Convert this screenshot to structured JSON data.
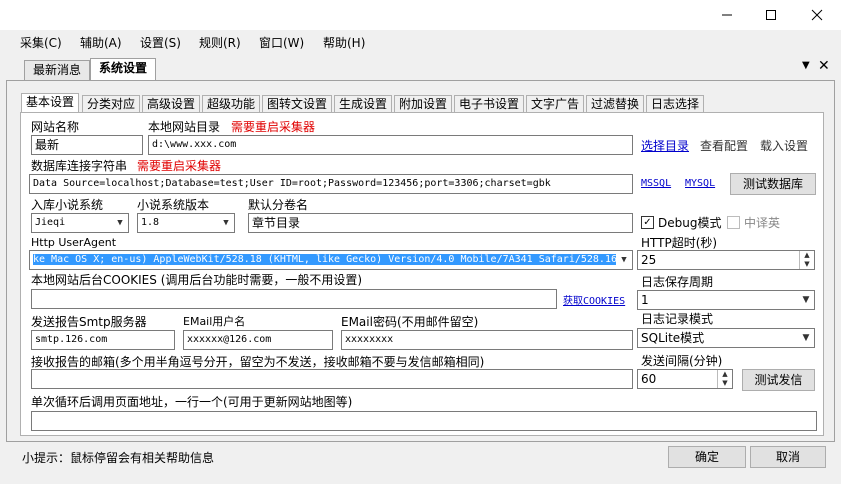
{
  "menu": {
    "items": [
      "采集(C)",
      "辅助(A)",
      "设置(S)",
      "规则(R)",
      "窗口(W)",
      "帮助(H)"
    ]
  },
  "doc_tabs": {
    "tabs": [
      "最新消息",
      "系统设置"
    ],
    "active": "系统设置"
  },
  "sub_tabs": {
    "tabs": [
      "基本设置",
      "分类对应",
      "高级设置",
      "超级功能",
      "图转文设置",
      "生成设置",
      "附加设置",
      "电子书设置",
      "文字广告",
      "过滤替换",
      "日志选择"
    ],
    "active": "基本设置"
  },
  "form": {
    "site_name_label": "网站名称",
    "site_name_value": "最新",
    "local_dir_label": "本地网站目录",
    "restart_note": "需要重启采集器",
    "local_dir_value": "d:\\www.xxx.com",
    "select_dir_link": "选择目录",
    "view_config": "查看配置",
    "load_settings": "载入设置",
    "db_conn_label": "数据库连接字符串",
    "db_conn_note": "需要重启采集器",
    "db_conn_value": "Data Source=localhost;Database=test;User ID=root;Password=123456;port=3306;charset=gbk",
    "mssql_link": "MSSQL",
    "mysql_link": "MYSQL",
    "test_db_button": "测试数据库",
    "novel_system_label": "入库小说系统",
    "novel_system_value": "Jieqi",
    "novel_version_label": "小说系统版本",
    "novel_version_value": "1.8",
    "default_volume_label": "默认分卷名",
    "default_volume_value": "章节目录",
    "debug_mode_label": "Debug模式",
    "debug_mode_checked": true,
    "zh_en_label": "中译英",
    "zh_en_checked": false,
    "user_agent_label": "Http UserAgent",
    "user_agent_value": "ke Mac OS X; en-us) AppleWebKit/528.18 (KHTML, like Gecko) Version/4.0 Mobile/7A341 Safari/528.16",
    "http_timeout_label": "HTTP超时(秒)",
    "http_timeout_value": "25",
    "cookies_label": "本地网站后台COOKIES (调用后台功能时需要，一般不用设置)",
    "cookies_value": "",
    "get_cookies_link": "获取COOKIES",
    "log_period_label": "日志保存周期",
    "log_period_value": "1",
    "smtp_label": "发送报告Smtp服务器",
    "smtp_value": "smtp.126.com",
    "email_user_label": "EMail用户名",
    "email_user_value": "xxxxxx@126.com",
    "email_pwd_label": "EMail密码(不用邮件留空)",
    "email_pwd_value": "xxxxxxxx",
    "log_mode_label": "日志记录模式",
    "log_mode_value": "SQLite模式",
    "recv_mail_label": "接收报告的邮箱(多个用半角逗号分开，留空为不发送，接收邮箱不要与发信邮箱相同)",
    "recv_mail_value": "",
    "send_interval_label": "发送间隔(分钟)",
    "send_interval_value": "60",
    "test_send_button": "测试发信",
    "loop_url_label": "单次循环后调用页面地址，一行一个(可用于更新网站地图等)",
    "loop_url_value": ""
  },
  "footer": {
    "tip": "小提示：鼠标停留会有相关帮助信息",
    "ok_button": "确定",
    "cancel_button": "取消"
  }
}
